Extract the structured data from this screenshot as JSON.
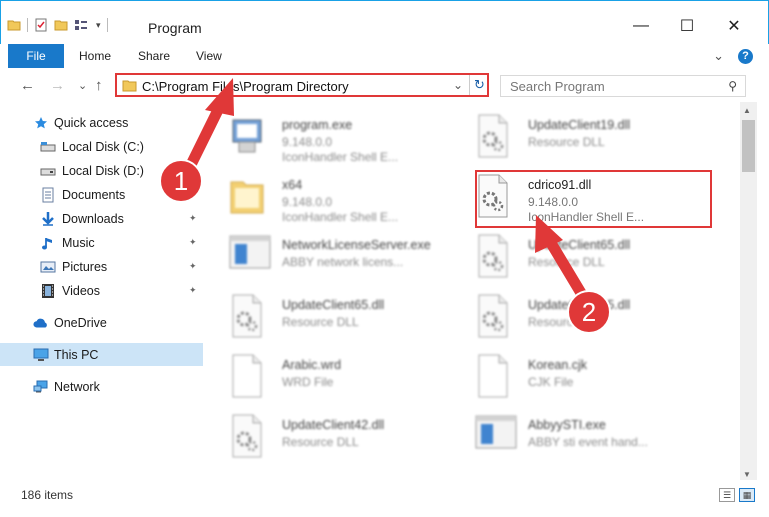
{
  "window": {
    "title": "Program",
    "min_glyph": "—",
    "max_glyph": "☐",
    "close_glyph": "✕"
  },
  "ribbon": {
    "tabs": [
      "File",
      "Home",
      "Share",
      "View"
    ],
    "collapse_glyph": "⌄",
    "help_glyph": "?"
  },
  "nav": {
    "back_glyph": "←",
    "forward_glyph": "→",
    "recent_glyph": "⌄",
    "up_glyph": "↑",
    "address": "C:\\Program Files\\Program Directory",
    "address_dropdown_glyph": "⌄",
    "refresh_glyph": "↻",
    "search_placeholder": "Search Program",
    "search_glyph": "⚲"
  },
  "sidebar": {
    "items": [
      {
        "label": "Quick access",
        "icon": "star-icon"
      },
      {
        "label": "Local Disk (C:)",
        "icon": "drive-icon"
      },
      {
        "label": "Local Disk (D:)",
        "icon": "drive-icon"
      },
      {
        "label": "Documents",
        "icon": "documents-icon"
      },
      {
        "label": "Downloads",
        "icon": "download-icon"
      },
      {
        "label": "Music",
        "icon": "music-icon"
      },
      {
        "label": "Pictures",
        "icon": "pictures-icon"
      },
      {
        "label": "Videos",
        "icon": "videos-icon"
      },
      {
        "label": "OneDrive",
        "icon": "cloud-icon"
      },
      {
        "label": "This PC",
        "icon": "computer-icon"
      },
      {
        "label": "Network",
        "icon": "network-icon"
      }
    ],
    "pin_glyph": "📌"
  },
  "files": [
    {
      "name": "program.exe",
      "line1": "9.148.0.0",
      "line2": "IconHandler Shell E...",
      "icon": "exe-icon"
    },
    {
      "name": "UpdateClient19.dll",
      "line1": "Resource DLL",
      "line2": "",
      "icon": "dll-icon"
    },
    {
      "name": "x64",
      "line1": "9.148.0.0",
      "line2": "IconHandler Shell E...",
      "icon": "folder-icon"
    },
    {
      "name": "cdrico91.dll",
      "line1": "9.148.0.0",
      "line2": "IconHandler Shell E...",
      "icon": "dll-icon"
    },
    {
      "name": "NetworkLicenseServer.exe",
      "line1": "ABBY network licens...",
      "line2": "",
      "icon": "window-icon"
    },
    {
      "name": "UpdateClient65.dll",
      "line1": "Resource DLL",
      "line2": "",
      "icon": "dll-icon"
    },
    {
      "name": "UpdateClient65.dll",
      "line1": "Resource DLL",
      "line2": "",
      "icon": "dll-icon"
    },
    {
      "name": "UpdateClient25.dll",
      "line1": "Resource DLL",
      "line2": "",
      "icon": "dll-icon"
    },
    {
      "name": "Arabic.wrd",
      "line1": "WRD File",
      "line2": "",
      "icon": "blank-file-icon"
    },
    {
      "name": "Korean.cjk",
      "line1": "CJK File",
      "line2": "",
      "icon": "blank-file-icon"
    },
    {
      "name": "UpdateClient42.dll",
      "line1": "Resource DLL",
      "line2": "",
      "icon": "dll-icon"
    },
    {
      "name": "AbbyySTI.exe",
      "line1": "ABBY sti event hand...",
      "line2": "",
      "icon": "window-icon"
    }
  ],
  "callouts": [
    "1",
    "2"
  ],
  "status": {
    "count": "186 items"
  },
  "colors": {
    "accent": "#1979ca",
    "highlight": "#e03838",
    "selected": "#cce4f7"
  }
}
